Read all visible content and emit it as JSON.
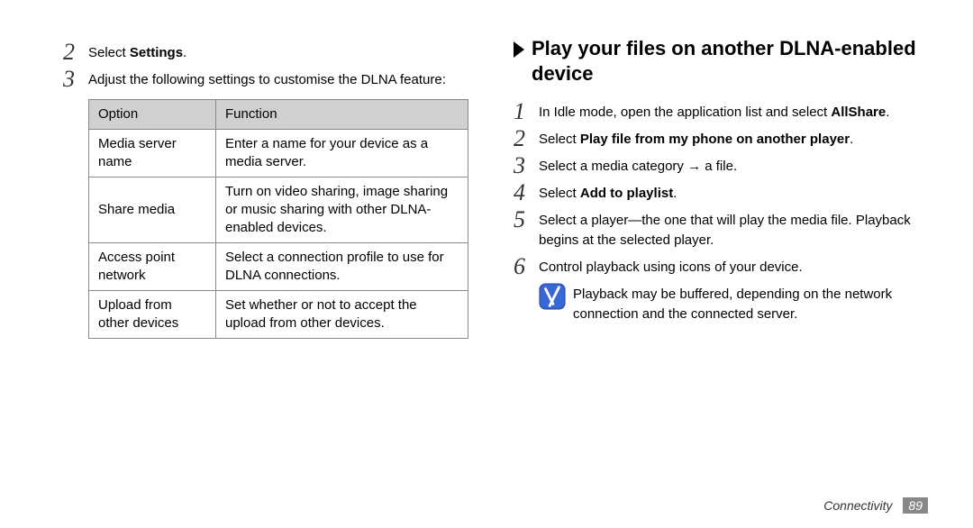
{
  "left": {
    "step2": {
      "num": "2",
      "pre": "Select ",
      "bold": "Settings",
      "post": "."
    },
    "step3": {
      "num": "3",
      "text": "Adjust the following settings to customise the DLNA feature:"
    },
    "table": {
      "headers": [
        "Option",
        "Function"
      ],
      "rows": [
        [
          "Media server name",
          "Enter a name for your device as a media server."
        ],
        [
          "Share media",
          "Turn on video sharing, image sharing or music sharing with other DLNA-enabled devices."
        ],
        [
          "Access point network",
          "Select a connection profile to use for DLNA connections."
        ],
        [
          "Upload from other devices",
          "Set whether or not to accept the upload from other devices."
        ]
      ]
    }
  },
  "right": {
    "title": "Play your files on another DLNA-enabled device",
    "step1": {
      "num": "1",
      "pre": "In Idle mode, open the application list and select ",
      "bold": "AllShare",
      "post": "."
    },
    "step2": {
      "num": "2",
      "pre": "Select ",
      "bold": "Play file from my phone on another player",
      "post": "."
    },
    "step3": {
      "num": "3",
      "text": "Select a media category → a file."
    },
    "step4": {
      "num": "4",
      "pre": "Select ",
      "bold": "Add to playlist",
      "post": "."
    },
    "step5": {
      "num": "5",
      "text": "Select a player—the one that will play the media file. Playback begins at the selected player."
    },
    "step6": {
      "num": "6",
      "text": "Control playback using icons of your device."
    },
    "note": "Playback may be buffered, depending on the network connection and the connected server."
  },
  "footer": {
    "chapter": "Connectivity",
    "page": "89"
  }
}
